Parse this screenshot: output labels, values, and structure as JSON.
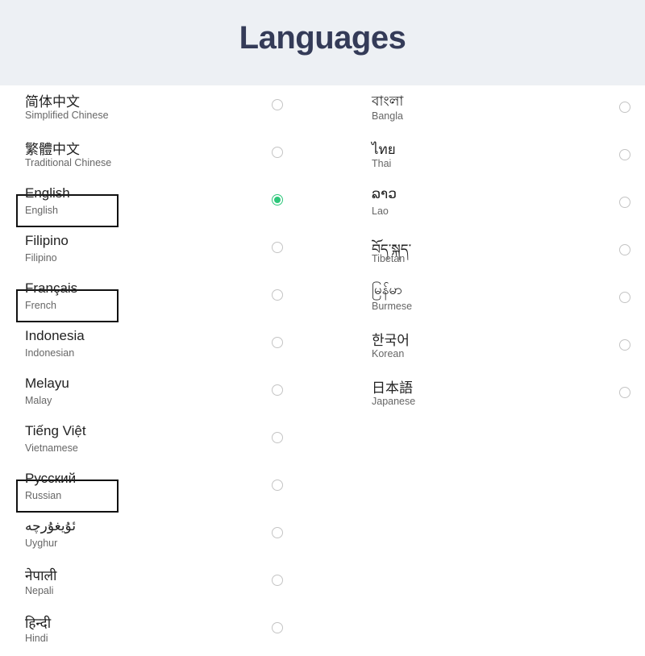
{
  "header": {
    "title": "Languages"
  },
  "accent": "#2dc77a",
  "left": [
    {
      "native": "简体中文",
      "english": "Simplified Chinese",
      "selected": false,
      "highlighted": false
    },
    {
      "native": "繁體中文",
      "english": "Traditional Chinese",
      "selected": false,
      "highlighted": false
    },
    {
      "native": "English",
      "english": "English",
      "selected": true,
      "highlighted": true
    },
    {
      "native": "Filipino",
      "english": "Filipino",
      "selected": false,
      "highlighted": false
    },
    {
      "native": "Français",
      "english": "French",
      "selected": false,
      "highlighted": true
    },
    {
      "native": "Indonesia",
      "english": "Indonesian",
      "selected": false,
      "highlighted": false
    },
    {
      "native": "Melayu",
      "english": "Malay",
      "selected": false,
      "highlighted": false
    },
    {
      "native": "Tiếng Việt",
      "english": "Vietnamese",
      "selected": false,
      "highlighted": false
    },
    {
      "native": "Русский",
      "english": "Russian",
      "selected": false,
      "highlighted": true
    },
    {
      "native": "ئۇيغۇرچە",
      "english": "Uyghur",
      "selected": false,
      "highlighted": false
    },
    {
      "native": "नेपाली",
      "english": "Nepali",
      "selected": false,
      "highlighted": false
    },
    {
      "native": "हिन्दी",
      "english": "Hindi",
      "selected": false,
      "highlighted": false
    }
  ],
  "right": [
    {
      "native": "বাংলা",
      "english": "Bangla",
      "selected": false
    },
    {
      "native": "ไทย",
      "english": "Thai",
      "selected": false
    },
    {
      "native": "ລາວ",
      "english": "Lao",
      "selected": false
    },
    {
      "native": "བོད་སྐད་",
      "english": "Tibetan",
      "selected": false
    },
    {
      "native": "မြန်မာ",
      "english": "Burmese",
      "selected": false
    },
    {
      "native": "한국어",
      "english": "Korean",
      "selected": false
    },
    {
      "native": "日本語",
      "english": "Japanese",
      "selected": false
    }
  ]
}
